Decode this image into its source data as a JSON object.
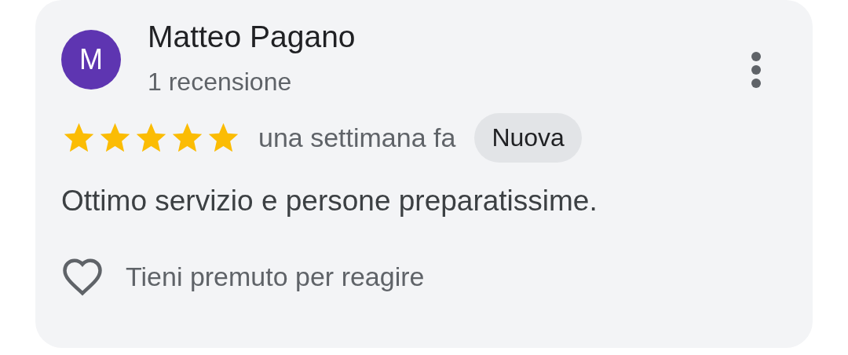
{
  "review": {
    "author": "Matteo Pagano",
    "avatar_letter": "M",
    "review_count": "1 recensione",
    "stars": 5,
    "time": "una settimana fa",
    "badge": "Nuova",
    "text": "Ottimo servizio e persone preparatissime.",
    "reaction_hint": "Tieni premuto per reagire"
  }
}
